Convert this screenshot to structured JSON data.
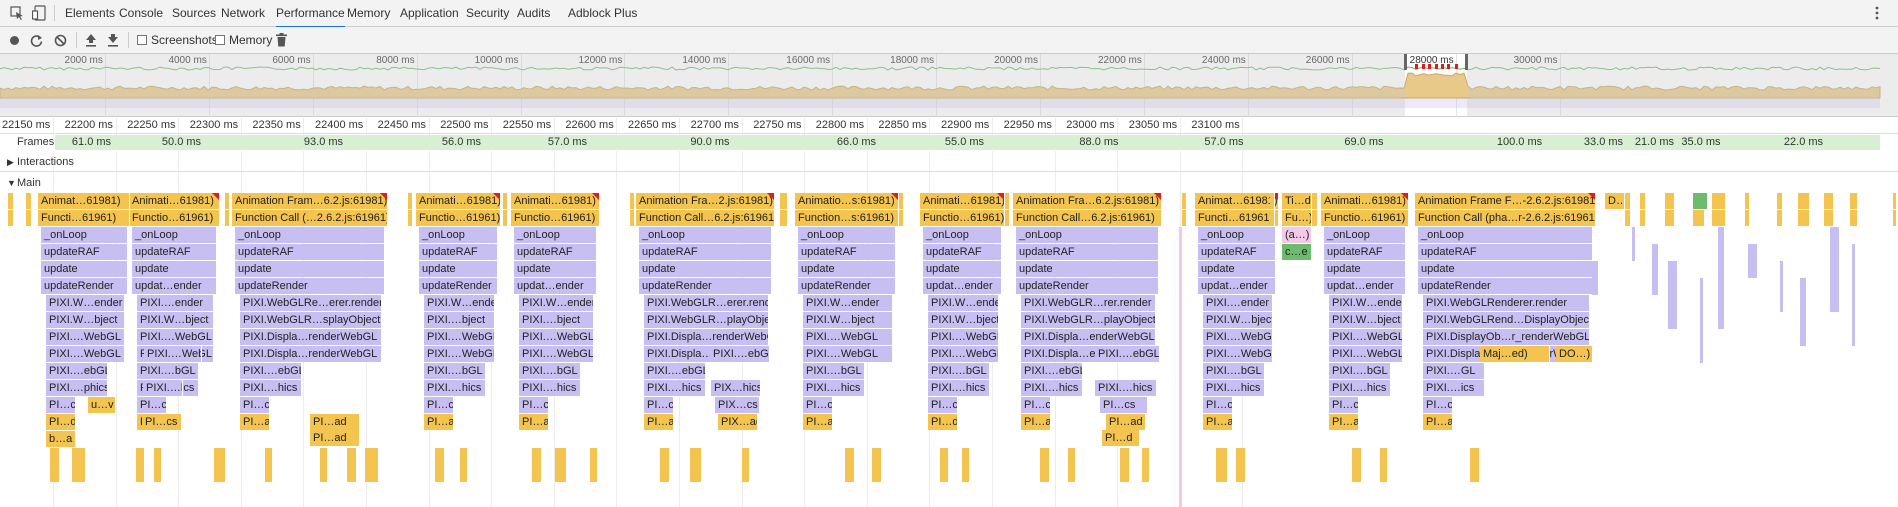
{
  "devtools_tabs": [
    "Elements",
    "Console",
    "Sources",
    "Network",
    "Performance",
    "Memory",
    "Application",
    "Security",
    "Audits",
    "Adblock Plus"
  ],
  "active_tab": "Performance",
  "toolbar": {
    "screenshots_label": "Screenshots",
    "memory_label": "Memory",
    "screenshots_checked": false,
    "memory_checked": false
  },
  "overview_ticks": [
    "2000 ms",
    "4000 ms",
    "6000 ms",
    "8000 ms",
    "10000 ms",
    "12000 ms",
    "14000 ms",
    "16000 ms",
    "18000 ms",
    "20000 ms",
    "22000 ms",
    "24000 ms",
    "26000 ms",
    "28000 ms",
    "30000 ms"
  ],
  "detail_ticks": [
    "22150 ms",
    "22200 ms",
    "22250 ms",
    "22300 ms",
    "22350 ms",
    "22400 ms",
    "22450 ms",
    "22500 ms",
    "22550 ms",
    "22600 ms",
    "22650 ms",
    "22700 ms",
    "22750 ms",
    "22800 ms",
    "22850 ms",
    "22900 ms",
    "22950 ms",
    "23000 ms",
    "23050 ms",
    "23100 ms"
  ],
  "frames_label": "Frames",
  "frames": [
    "61.0 ms",
    "50.0 ms",
    "93.0 ms",
    "56.0 ms",
    "57.0 ms",
    "90.0 ms",
    "66.0 ms",
    "55.0 ms",
    "88.0 ms",
    "57.0 ms",
    "69.0 ms",
    "100.0 ms",
    "33.0 ms",
    "21.0 ms",
    "35.0 ms",
    "22.0 ms"
  ],
  "tracks": {
    "interactions": "Interactions",
    "main": "Main"
  },
  "flame_columns": [
    [
      "Animat…61981)",
      "Functi…61961)",
      "_onLoop",
      "updateRAF",
      "update",
      "updateRender",
      "PIXI.W…ender",
      "PIXI.W…bject",
      "PIXI.…WebGL",
      "PIXI.…WebGL",
      "PIXI.…ebGL",
      "PIXI.…phics",
      "PI…cs",
      "PI…d",
      "b…a"
    ],
    [
      "Animati…61981)",
      "Functio…61961)",
      "_onLoop",
      "updateRAF",
      "update",
      "updat…ender",
      "PIXI.…ender",
      "PIXI.W…bject",
      "PIXI.…WebGL",
      "PIXI.…WebGL",
      "PIXI.…bGL",
      "PIXI.…hics",
      "PI…cs",
      "PI…ad"
    ],
    [
      "Animation Fram…6.2.js:61981)",
      "Function Call (…2.6.2.js:61961)",
      "_onLoop",
      "updateRAF",
      "update",
      "updateRender",
      "PIXI.WebGLRe…erer.render",
      "PIXI.WebGLR…splayObject",
      "PIXI.Displa…renderWebGL",
      "PIXI.Displa…renderWebGL",
      "PIXI.…ebGL",
      "PIXI.…hics",
      "PI…cs",
      "PI…ad"
    ],
    [
      "Animati…61981)",
      "Functio…61961)",
      "_onLoop",
      "updateRAF",
      "update",
      "updateRender",
      "PIXI.W…ender",
      "PIXI.…bject",
      "PIXI.…WebGL",
      "PIXI.…WebGL",
      "PIXI.…bGL",
      "PIXI.…hics",
      "PI…cs",
      "PI…ad"
    ],
    [
      "Animati…61981)",
      "Functio…61961)",
      "_onLoop",
      "updateRAF",
      "update",
      "updat…ender",
      "PIXI.W…ender",
      "PIXI.…bject",
      "PIXI.…WebGL",
      "PIXI.…WebGL",
      "PIXI.…bGL",
      "PIXI.…hics",
      "PI…cs",
      "PI…ad"
    ],
    [
      "Animation Fra…2.js:61981)",
      "Function Call…6.2.js:61961)",
      "_onLoop",
      "updateRAF",
      "update",
      "updateRender",
      "PIXI.WebGLR…erer.render",
      "PIXI.WebGLR…playObject",
      "PIXI.Displa…renderWebGL",
      "PIXI.Displa…renderWebGL",
      "PIXI.…ebGL",
      "PIXI.…hics",
      "PI…cs",
      "PI…ad"
    ],
    [
      "Animatio…s:61981)",
      "Function…s:61961)",
      "_onLoop",
      "updateRAF",
      "update",
      "updateRender",
      "PIXI.W…ender",
      "PIXI.W…bject",
      "PIXI.…WebGL",
      "PIXI.…WebGL",
      "PIXI.…bGL",
      "PIXI.…hics",
      "PI…cs",
      "PI…ad"
    ],
    [
      "Animati…61981)",
      "Functio…61961)",
      "_onLoop",
      "updateRAF",
      "update",
      "updat…ender",
      "PIXI.W…ender",
      "PIXI.W…bject",
      "PIXI.…WebGL",
      "PIXI.…WebGL",
      "PIXI.…bGL",
      "PIXI.…hics",
      "PI…cs",
      "PI…d"
    ],
    [
      "Animation Fra…6.2.js:61981)",
      "Function Call…6.2.js:61961)",
      "_onLoop",
      "updateRAF",
      "update",
      "updateRender",
      "PIXI.WebGLR…rer.render",
      "PIXI.WebGLR…playObject",
      "PIXI.Displa…enderWebGL",
      "PIXI.Displa…enderWebGL",
      "PIXI.…ebGL",
      "PIXI.…hics",
      "PI…cs",
      "PI…ad"
    ],
    [
      "Animat…61981)",
      "Functi…61961)",
      "_onLoop",
      "updateRAF",
      "update",
      "updat…ender",
      "PIXI.…ender",
      "PIXI.W…bject",
      "PIXI.…WebGL",
      "PIXI.…WebGL",
      "PIXI.…bGL",
      "PIXI.…hics",
      "PI…cs",
      "PI…ad"
    ],
    [
      "Ti…d",
      "Fu…)",
      "(a…)",
      "c…e"
    ],
    [
      "Animati…61981)",
      "Functio…61961)",
      "_onLoop",
      "updateRAF",
      "update",
      "updat…ender",
      "PIXI.W…ender",
      "PIXI.W…bject",
      "PIXI.…WebGL",
      "PIXI.…WebGL",
      "PIXI.…bGL",
      "PIXI.…hics",
      "PI…cs",
      "PI…ad"
    ],
    [
      "Animation Frame F…-2.6.2.js:61981)",
      "Function Call (pha…r-2.6.2.js:61961)",
      "_onLoop",
      "updateRAF",
      "update",
      "updateRender",
      "PIXI.WebGLRenderer.render",
      "PIXI.WebGLRend…DisplayObject",
      "PIXI.DisplayOb…r_renderWebGL",
      "PIXI.DisplayOb…r_renderWebGL",
      "PIXI.…GL",
      "PIXI.…ics",
      "PI…cs",
      "PI…ad"
    ]
  ],
  "side_labels": [
    "u…v",
    "PIXI.…WebGL",
    "PIXI.…hics",
    "PI…cs",
    "PI…ad",
    "PI…ad",
    "PIXI.…ebGL",
    "PIX…hics",
    "PIX…cs",
    "PIX…ad",
    "PIXI.…ebGL",
    "PIXI.…hics",
    "PI…cs",
    "PI…ad",
    "PI…d",
    "Maj…ed)",
    "DO…)",
    "D…"
  ]
}
